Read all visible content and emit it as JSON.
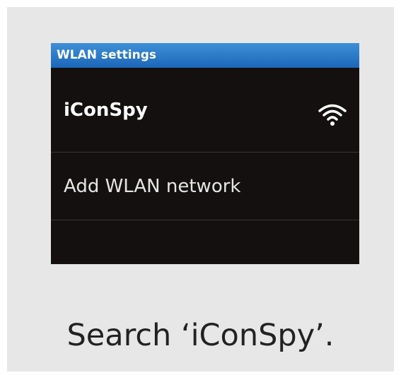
{
  "wlan": {
    "title": "WLAN settings",
    "network_name": "iConSpy",
    "network_icon": "wifi-icon",
    "add_network_label": "Add WLAN network"
  },
  "caption": "Search ‘iConSpy’.",
  "colors": {
    "titlebar": "#2574c6",
    "screen_background": "#151010",
    "card_background": "#e7e7e7"
  }
}
